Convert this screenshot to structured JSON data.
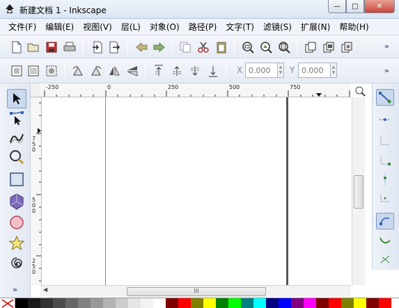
{
  "window": {
    "title": "新建文档 1 - Inkscape",
    "buttons": {
      "minimize": "—",
      "maximize": "□",
      "close": "✕"
    }
  },
  "menu": [
    "文件(F)",
    "编辑(E)",
    "视图(V)",
    "层(L)",
    "对象(O)",
    "路径(P)",
    "文字(T)",
    "滤镜(S)",
    "扩展(N)",
    "帮助(H)"
  ],
  "toolbar_commands": {
    "more": "»"
  },
  "toolbar_tool_controls": {
    "x_label": "X",
    "x_value": "0.000",
    "y_label": "Y",
    "y_value": "0.000",
    "more": "»"
  },
  "ruler": {
    "h_ticks": [
      "-250",
      "0",
      "250",
      "500",
      "750"
    ],
    "v_ticks": [
      "750",
      "500",
      "250"
    ]
  },
  "toolbox_more": "»",
  "hscroll_grip": "III",
  "palette": [
    "#000000",
    "#1a1a1a",
    "#333333",
    "#4d4d4d",
    "#666666",
    "#808080",
    "#999999",
    "#b3b3b3",
    "#cccccc",
    "#e6e6e6",
    "#f2f2f2",
    "#ffffff",
    "#800000",
    "#ff0000",
    "#808000",
    "#ffff00",
    "#008000",
    "#00ff00",
    "#008080",
    "#00ffff",
    "#000080",
    "#0000ff",
    "#800080",
    "#ff00ff",
    "#800000",
    "#ff0000",
    "#808000",
    "#ffff00",
    "#800000",
    "#ff0000"
  ]
}
